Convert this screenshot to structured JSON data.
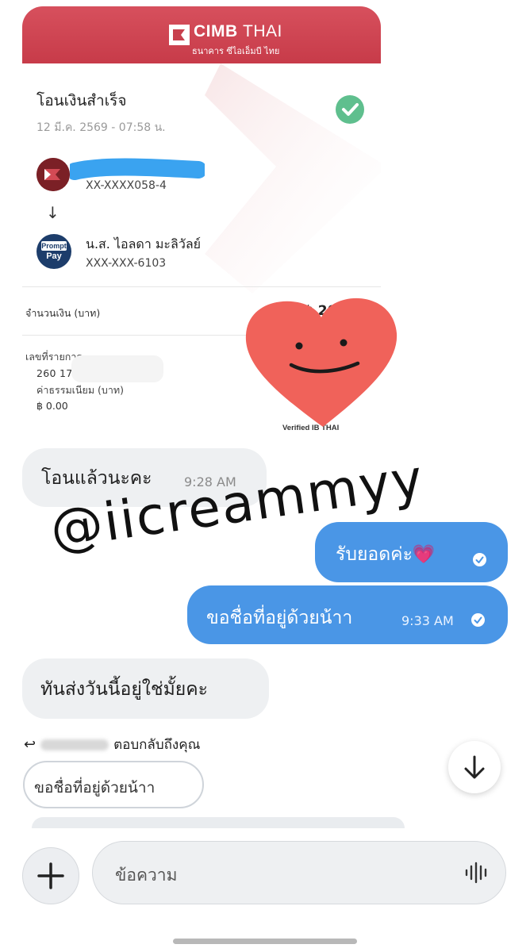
{
  "receipt": {
    "bank_name_bold": "CIMB",
    "bank_name_thin": "THAI",
    "bank_sub": "ธนาคาร ซีไอเอ็มบี ไทย",
    "title": "โอนเงินสำเร็จ",
    "date": "12 มี.ค. 2569 - 07:58 น.",
    "sender_account": "XX-XXXX058-4",
    "receiver_name": "น.ส. ไอลดา มะลิวัลย์",
    "receiver_account": "XXX-XXX-6103",
    "promptpay_top": "Prompt",
    "promptpay_bottom": "Pay",
    "amount_label": "จำนวนเงิน (บาท)",
    "amount_value": "฿ 20",
    "ref_label": "เลขที่รายการ",
    "ref_value": "260                 17986",
    "fee_label": "ค่าธรรมเนียม (บาท)",
    "fee_value": "฿ 0.00",
    "verified": "Verified        IB THAI"
  },
  "chat": {
    "messages": [
      {
        "text": "โอนแล้วนะคะ",
        "time": "9:28 AM"
      },
      {
        "text": "รับยอดค่ะ💗"
      },
      {
        "text": "ขอชื่อที่อยู่ด้วยน้าา",
        "time": "9:33 AM"
      },
      {
        "text": "ทันส่งวันนี้อยู่ใช่มั้ยคะ"
      }
    ],
    "reply_suffix": "ตอบกลับถึงคุณ",
    "quick_reply": "ขอชื่อที่อยู่ด้วยน้าา"
  },
  "watermark": "@iicreammyy",
  "composer": {
    "placeholder": "ข้อความ"
  },
  "icons": {
    "add": "plus-icon",
    "voice": "voice-wave-icon",
    "scroll": "arrow-down-icon",
    "check": "check-icon",
    "read": "read-check-icon"
  },
  "colors": {
    "cimb_red": "#c8404d",
    "outgoing_bubble": "#4a96e6",
    "incoming_bubble": "#eef0f2",
    "success_green": "#5fbf8e",
    "heart": "#f0625a"
  }
}
